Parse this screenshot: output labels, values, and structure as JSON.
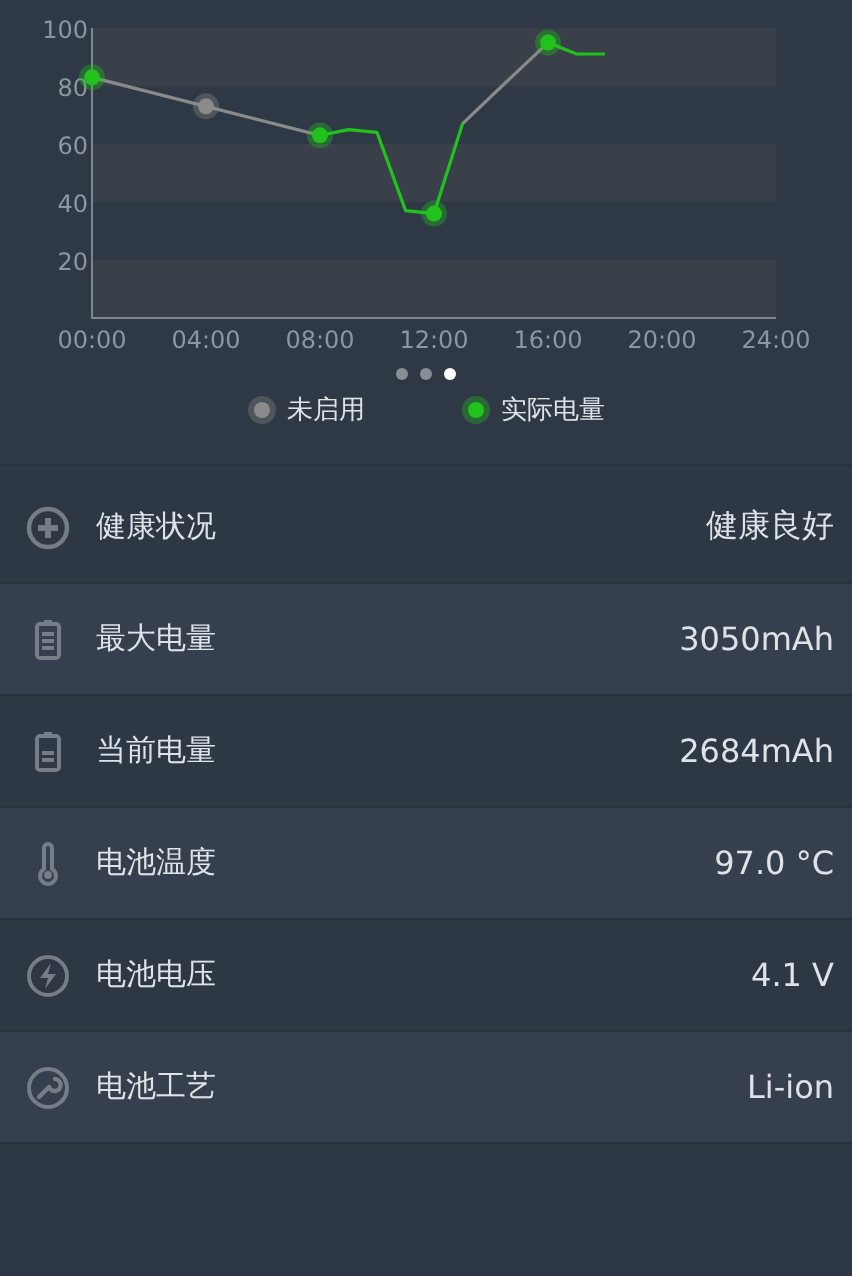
{
  "chart_data": {
    "type": "line",
    "x": [
      0,
      4,
      8,
      9,
      10,
      11,
      12,
      13,
      14.5,
      16,
      17,
      18
    ],
    "series": [
      {
        "name": "未启用",
        "color": "#8a8a8a",
        "values": [
          83,
          73,
          63,
          null,
          null,
          null,
          null,
          67,
          81,
          95,
          null,
          null
        ]
      },
      {
        "name": "实际电量",
        "color": "#22c21d",
        "values": [
          83,
          null,
          63,
          65,
          64,
          37,
          36,
          67,
          null,
          95,
          91,
          91
        ]
      }
    ],
    "xlim": [
      0,
      24
    ],
    "ylim": [
      0,
      100
    ],
    "xticks": [
      {
        "value": 0,
        "label": "00:00"
      },
      {
        "value": 4,
        "label": "04:00"
      },
      {
        "value": 8,
        "label": "08:00"
      },
      {
        "value": 12,
        "label": "12:00"
      },
      {
        "value": 16,
        "label": "16:00"
      },
      {
        "value": 20,
        "label": "20:00"
      },
      {
        "value": 24,
        "label": "24:00"
      }
    ],
    "yticks": [
      20,
      40,
      60,
      80,
      100
    ]
  },
  "pager": [
    {
      "selected": false
    },
    {
      "selected": false
    },
    {
      "selected": true
    }
  ],
  "rows": [
    {
      "label": "健康状况",
      "value": "健康良好"
    },
    {
      "label": "最大电量",
      "value": "3050mAh"
    },
    {
      "label": "当前电量",
      "value": "2684mAh"
    },
    {
      "label": "电池温度",
      "value": "97.0 °C"
    },
    {
      "label": "电池电压",
      "value": "4.1 V"
    },
    {
      "label": "电池工艺",
      "value": "Li-ion"
    }
  ]
}
